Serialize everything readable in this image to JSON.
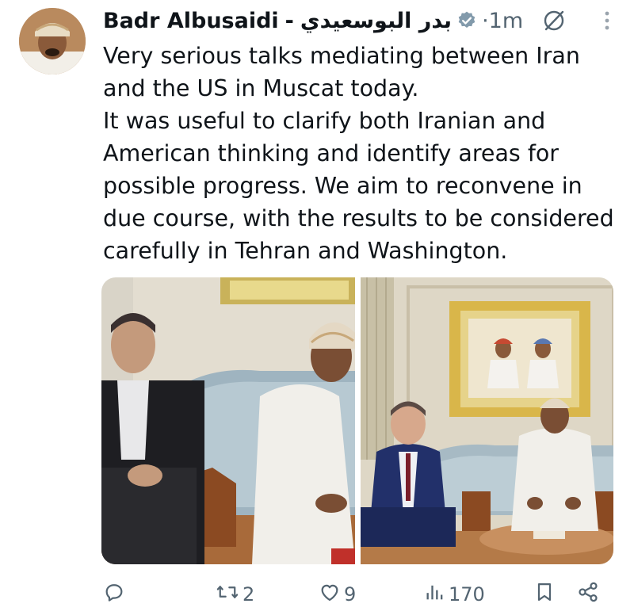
{
  "tweet": {
    "author_name": "Badr Albusaidi",
    "separator": "-",
    "author_name_arabic": "بدر البوسعيدي",
    "timestamp": "1m",
    "dot": "·",
    "icons": {
      "verified": "verified-badge-icon",
      "grok": "grok-icon",
      "more": "more-vertical-icon"
    },
    "text_paragraphs": [
      "Very serious talks mediating between Iran and the US in Muscat today.",
      "It was useful to clarify both Iranian and American thinking and identify areas for possible progress. We aim to reconvene in due course, with the results to be considered carefully in Tehran and Washington."
    ],
    "media_count": 2
  },
  "actions": {
    "replies": "",
    "reposts": "2",
    "likes": "9",
    "views": "170",
    "icons": [
      "reply-icon",
      "repost-icon",
      "like-icon",
      "views-icon",
      "bookmark-icon",
      "share-icon"
    ]
  },
  "colors": {
    "text": "#0f1419",
    "secondary": "#536471",
    "verified_badge": "#829aab"
  }
}
